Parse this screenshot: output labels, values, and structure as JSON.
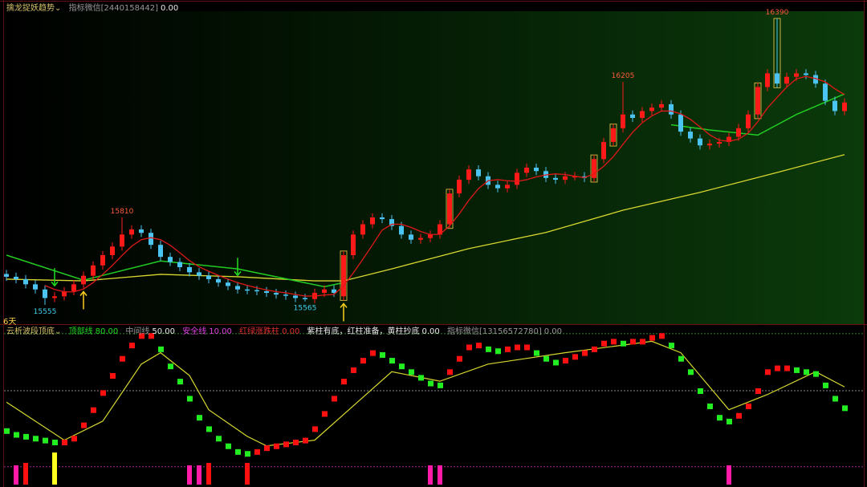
{
  "top_panel": {
    "indicator_name": "擒龙捉妖趋势",
    "wechat_label": "指标微信[2440158442]",
    "wechat_value": "0.00",
    "days_label": "6天"
  },
  "bottom_panel": {
    "indicator_name": "云析波段顶底",
    "top_line_label": "顶部线",
    "top_line_value": "80.00",
    "mid_line_label": "中间线",
    "mid_line_value": "50.00",
    "safe_line_label": "安全线",
    "safe_line_value": "10.00",
    "updown_label": "红绿涨跌柱",
    "updown_value": "0.00",
    "signal_label": "紫柱有底，红柱准备，黄柱抄底",
    "signal_value": "0.00",
    "wechat_label": "指标微信[13156572780]",
    "wechat_value": "0.00"
  },
  "colors": {
    "up": "#ff1a1a",
    "down": "#4cc4f2",
    "ma_short": "#e01818",
    "ma_green": "#22cc22",
    "ma_long": "#d8d830",
    "osc_up": "#ff1010",
    "osc_down": "#22ee22",
    "pink": "#ff1aa8",
    "red": "#ff1010",
    "yellow": "#ffff20"
  },
  "chart_data": [
    {
      "type": "candlestick",
      "ylim": [
        15555,
        16390
      ],
      "close": [
        15637,
        15630,
        15615,
        15600,
        15575,
        15580,
        15595,
        15615,
        15640,
        15670,
        15700,
        15725,
        15760,
        15775,
        15765,
        15730,
        15695,
        15680,
        15665,
        15650,
        15640,
        15630,
        15620,
        15610,
        15600,
        15598,
        15595,
        15590,
        15585,
        15582,
        15575,
        15572,
        15590,
        15600,
        15590,
        15700,
        15760,
        15790,
        15810,
        15805,
        15785,
        15760,
        15745,
        15750,
        15760,
        15790,
        15880,
        15920,
        15950,
        15930,
        15905,
        15895,
        15905,
        15940,
        15955,
        15945,
        15925,
        15920,
        15930,
        15930,
        15925,
        15980,
        16030,
        16070,
        16110,
        16100,
        16120,
        16130,
        16140,
        16110,
        16060,
        16040,
        16020,
        16025,
        16030,
        16045,
        16070,
        16110,
        16190,
        16230,
        16200,
        16220,
        16230,
        16225,
        16200,
        16150,
        16120,
        16145
      ],
      "open_overrides": [
        {
          "index": 0,
          "open": 15645
        },
        {
          "index": 35,
          "open": 15580
        }
      ],
      "annotations": [
        {
          "index": 4,
          "kind": "low",
          "value": 15555,
          "label": "15555"
        },
        {
          "index": 12,
          "kind": "high",
          "value": 15810,
          "label": "15810"
        },
        {
          "index": 31,
          "kind": "low",
          "value": 15565,
          "label": "15565"
        },
        {
          "index": 64,
          "kind": "high",
          "value": 16205,
          "label": "16205"
        },
        {
          "index": 80,
          "kind": "high",
          "value": 16390,
          "label": "16390"
        }
      ],
      "long_ma": [
        [
          0,
          15630
        ],
        [
          8,
          15625
        ],
        [
          16,
          15644
        ],
        [
          24,
          15637
        ],
        [
          32,
          15625
        ],
        [
          35,
          15625
        ],
        [
          40,
          15660
        ],
        [
          48,
          15719
        ],
        [
          56,
          15766
        ],
        [
          64,
          15831
        ],
        [
          72,
          15883
        ],
        [
          80,
          15941
        ],
        [
          87,
          15993
        ]
      ],
      "green_line_segments": [
        [
          [
            0,
            15700
          ],
          [
            8,
            15627
          ],
          [
            16,
            15683
          ],
          [
            24,
            15660
          ],
          [
            33,
            15608
          ],
          [
            35,
            15620
          ]
        ],
        [
          [
            69,
            16080
          ],
          [
            73,
            16065
          ],
          [
            78,
            16050
          ],
          [
            82,
            16110
          ],
          [
            87,
            16170
          ]
        ]
      ],
      "buy_arrows": [
        8,
        35
      ],
      "sell_arrows": [
        5,
        24
      ],
      "boxed_candles": [
        35,
        46,
        61,
        63,
        78,
        80
      ]
    },
    {
      "type": "oscillator",
      "ylim": [
        0,
        100
      ],
      "levels": [
        80,
        50,
        10
      ],
      "fast": [
        29,
        27,
        26,
        25,
        24,
        23,
        23,
        25,
        32,
        40,
        49,
        58,
        67,
        74,
        79,
        79,
        72,
        63,
        55,
        46,
        36,
        30,
        25,
        21,
        18,
        17,
        18,
        20,
        21,
        22,
        23,
        24,
        30,
        38,
        46,
        55,
        61,
        66,
        70,
        69,
        66,
        63,
        60,
        57,
        54,
        53,
        60,
        67,
        73,
        74,
        72,
        71,
        72,
        73,
        73,
        70,
        67,
        65,
        66,
        68,
        70,
        72,
        75,
        76,
        75,
        76,
        76,
        78,
        79,
        74,
        67,
        60,
        50,
        42,
        36,
        34,
        37,
        42,
        50,
        60,
        62,
        62,
        61,
        60,
        59,
        53,
        46,
        41
      ],
      "slow": [
        [
          0,
          44
        ],
        [
          6,
          24
        ],
        [
          10,
          34
        ],
        [
          14,
          64
        ],
        [
          16,
          70
        ],
        [
          19,
          58
        ],
        [
          21,
          40
        ],
        [
          25,
          26
        ],
        [
          27,
          21
        ],
        [
          32,
          24
        ],
        [
          36,
          42
        ],
        [
          40,
          60
        ],
        [
          45,
          55
        ],
        [
          50,
          64
        ],
        [
          58,
          70
        ],
        [
          67,
          76
        ],
        [
          70,
          70
        ],
        [
          73,
          52
        ],
        [
          75,
          40
        ],
        [
          79,
          48
        ],
        [
          84,
          60
        ],
        [
          87,
          52
        ]
      ],
      "signal_bars": [
        {
          "index": 1,
          "color": "pink"
        },
        {
          "index": 2,
          "color": "red"
        },
        {
          "index": 5,
          "color": "yellow"
        },
        {
          "index": 19,
          "color": "pink"
        },
        {
          "index": 20,
          "color": "pink"
        },
        {
          "index": 21,
          "color": "red"
        },
        {
          "index": 25,
          "color": "red"
        },
        {
          "index": 44,
          "color": "pink"
        },
        {
          "index": 45,
          "color": "pink"
        },
        {
          "index": 75,
          "color": "pink"
        }
      ]
    }
  ]
}
